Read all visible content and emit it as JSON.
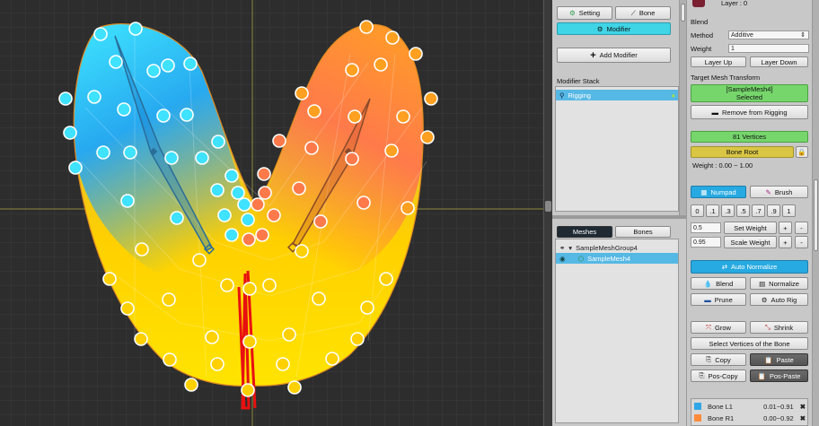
{
  "top": {
    "layer_label": "Layer : 0"
  },
  "mid_tabs": {
    "setting": "Setting",
    "bone": "Bone",
    "modifier": "Modifier"
  },
  "add_modifier": "Add Modifier",
  "modifier_stack": {
    "title": "Modifier Stack",
    "items": [
      {
        "label": "Rigging"
      }
    ]
  },
  "lower_tabs": {
    "meshes": "Meshes",
    "bones": "Bones"
  },
  "tree": {
    "group": "SampleMeshGroup4",
    "mesh": "SampleMesh4"
  },
  "blend": {
    "title": "Blend",
    "method_label": "Method",
    "method_value": "Additive",
    "weight_label": "Weight",
    "weight_value": "1",
    "layer_up": "Layer Up",
    "layer_down": "Layer Down"
  },
  "target": {
    "title": "Target Mesh Transform",
    "selected_name": "[SampleMesh4]",
    "selected_state": "Selected",
    "remove_btn": "Remove from Rigging"
  },
  "vertices": {
    "count_label": "81 Vertices",
    "bone_root": "Bone Root",
    "weight_range": "Weight : 0.00 ~ 1.00"
  },
  "tools": {
    "numpad": "Numpad",
    "brush": "Brush"
  },
  "numpad": [
    "0",
    ".1",
    ".3",
    ".5",
    ".7",
    ".9",
    "1"
  ],
  "set_weight": {
    "value": "0.5",
    "label": "Set Weight",
    "plus": "+",
    "minus": "-"
  },
  "scale_weight": {
    "value": "0.95",
    "label": "Scale Weight",
    "plus": "+",
    "minus": "-"
  },
  "auto_normalize": "Auto Normalize",
  "ops": {
    "blend": "Blend",
    "normalize": "Normalize",
    "prune": "Prune",
    "auto_rig": "Auto Rig",
    "grow": "Grow",
    "shrink": "Shrink",
    "select_vertices": "Select Vertices of the Bone",
    "copy": "Copy",
    "paste": "Paste",
    "pos_copy": "Pos-Copy",
    "pos_paste": "Pos-Paste"
  },
  "bone_list": [
    {
      "name": "Bone L1",
      "range": "0.01~0.91",
      "color": "#2fa7e6"
    },
    {
      "name": "Bone R1",
      "range": "0.00~0.92",
      "color": "#ff8c3a"
    }
  ],
  "colors": {
    "mesh_left": "#3fe2ff",
    "mesh_right": "#ffa020",
    "mesh_bottom": "#ffe000",
    "accent": "#3fd4e6"
  }
}
